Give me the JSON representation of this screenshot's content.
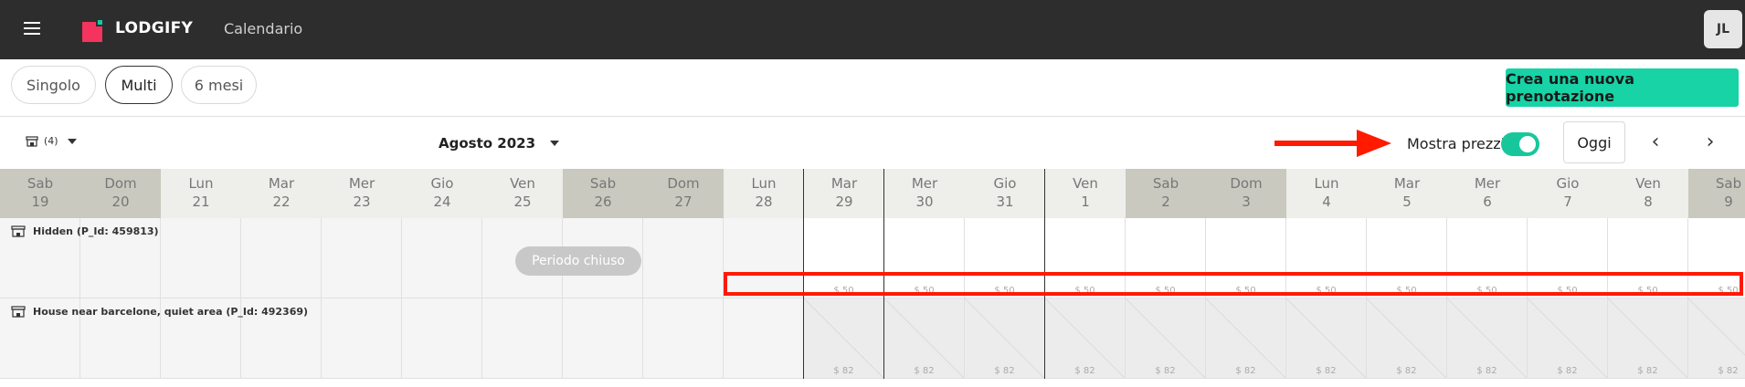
{
  "header": {
    "logo_text": "LODGIFY",
    "app_title": "Calendario",
    "avatar_initials": "JL"
  },
  "views": {
    "tabs": [
      {
        "label": "Singolo",
        "active": false
      },
      {
        "label": "Multi",
        "active": true
      },
      {
        "label": "6 mesi",
        "active": false
      }
    ],
    "new_booking_label": "Crea una nuova prenotazione"
  },
  "toolbar": {
    "property_count": "(4)",
    "month_label": "Agosto 2023",
    "show_prices_label": "Mostra prezzi",
    "show_prices_on": true,
    "today_label": "Oggi",
    "prev_label": "‹",
    "next_label": "›"
  },
  "days": [
    {
      "dow": "Sab",
      "num": "19",
      "weekend": true
    },
    {
      "dow": "Dom",
      "num": "20",
      "weekend": true
    },
    {
      "dow": "Lun",
      "num": "21",
      "weekend": false
    },
    {
      "dow": "Mar",
      "num": "22",
      "weekend": false
    },
    {
      "dow": "Mer",
      "num": "23",
      "weekend": false
    },
    {
      "dow": "Gio",
      "num": "24",
      "weekend": false
    },
    {
      "dow": "Ven",
      "num": "25",
      "weekend": false
    },
    {
      "dow": "Sab",
      "num": "26",
      "weekend": true
    },
    {
      "dow": "Dom",
      "num": "27",
      "weekend": true
    },
    {
      "dow": "Lun",
      "num": "28",
      "weekend": false
    },
    {
      "dow": "Mar",
      "num": "29",
      "weekend": false
    },
    {
      "dow": "Mer",
      "num": "30",
      "weekend": false
    },
    {
      "dow": "Gio",
      "num": "31",
      "weekend": false
    },
    {
      "dow": "Ven",
      "num": "1",
      "weekend": false
    },
    {
      "dow": "Sab",
      "num": "2",
      "weekend": true
    },
    {
      "dow": "Dom",
      "num": "3",
      "weekend": true
    },
    {
      "dow": "Lun",
      "num": "4",
      "weekend": false
    },
    {
      "dow": "Mar",
      "num": "5",
      "weekend": false
    },
    {
      "dow": "Mer",
      "num": "6",
      "weekend": false
    },
    {
      "dow": "Gio",
      "num": "7",
      "weekend": false
    },
    {
      "dow": "Ven",
      "num": "8",
      "weekend": false
    },
    {
      "dow": "Sab",
      "num": "9",
      "weekend": true
    }
  ],
  "properties": [
    {
      "name": "Hidden (P_Id: 459813)",
      "price": "$ 50",
      "closed_label": "Periodo chiuso"
    },
    {
      "name": "House near barcelone, quiet area (P_Id: 492369)",
      "price": "$ 82"
    }
  ],
  "colors": {
    "weekend_header": "#c9c9bf",
    "weekday_header": "#eeeeea",
    "past_cell": "#f5f5f5",
    "accent": "#17d3a6",
    "annotation": "#ff1a00"
  }
}
